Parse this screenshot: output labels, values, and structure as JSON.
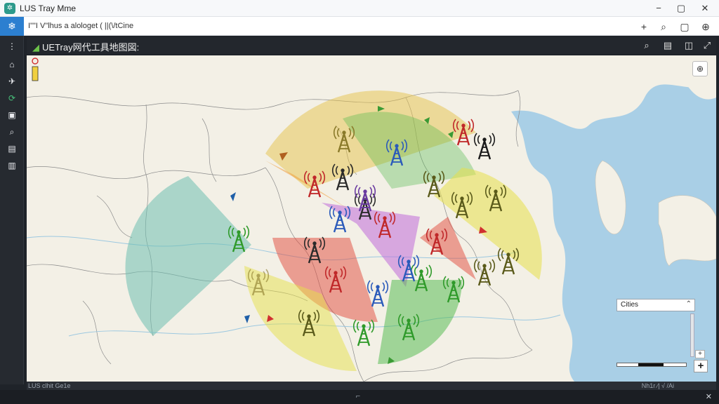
{
  "window": {
    "title": "LUS Tray Mme",
    "controls": [
      "−",
      "▢",
      "✕"
    ]
  },
  "menubar": {
    "breadcrumb": "I\"\"I V\"lhus a alologet  (  ||(\\/tCine",
    "tools": [
      "+",
      "⌕",
      "▢",
      "⊕"
    ]
  },
  "sidebar": {
    "items": [
      {
        "name": "grid",
        "glyph": "⋮"
      },
      {
        "name": "home",
        "glyph": "⌂"
      },
      {
        "name": "tower",
        "glyph": "✈"
      },
      {
        "name": "network",
        "glyph": "⟳"
      },
      {
        "name": "device",
        "glyph": "▣"
      },
      {
        "name": "search",
        "glyph": "⌕"
      },
      {
        "name": "report",
        "glyph": "▤"
      },
      {
        "name": "doc",
        "glyph": "▥"
      }
    ]
  },
  "map_header": {
    "title": "UETray网代工具地图図:",
    "tools": [
      "⌕",
      "▤",
      "◫",
      "⤢"
    ]
  },
  "map": {
    "cities_select": "Cities",
    "status_left": "LUS  clhit  Ge1e",
    "status_right": "Nh1r  ∕|   √ /Ai"
  },
  "colors": {
    "accent": "#2c7fd0",
    "sector_red": "#e24a3b",
    "sector_green": "#4cb848",
    "sector_yellow": "#e6e04a",
    "sector_teal": "#6dbfb0",
    "sector_purple": "#c06bd9",
    "sector_orange": "#f0a040",
    "sea": "#a8cfe6"
  },
  "icons": {
    "app": "app-logo-icon",
    "cell_tower": "cell-tower-icon"
  }
}
